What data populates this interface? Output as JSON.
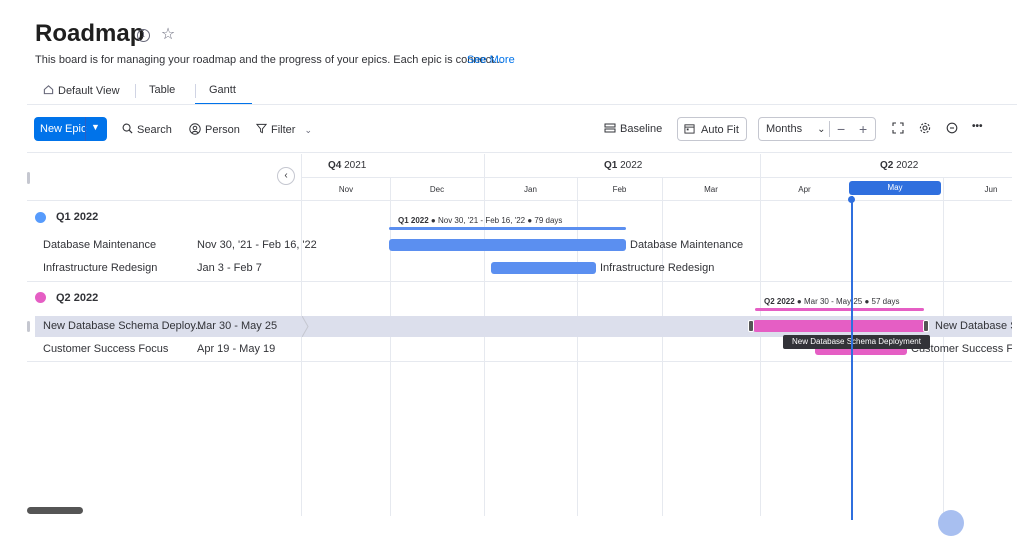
{
  "header": {
    "title": "Roadmap",
    "info_glyph": "i",
    "star_glyph": "☆",
    "description": "This board is for managing your roadmap and the progress of your epics. Each epic is connect...",
    "see_more": "See More"
  },
  "tabs": [
    {
      "label": "Default View",
      "icon": "home-icon"
    },
    {
      "label": "Table"
    },
    {
      "label": "Gantt",
      "active": true
    }
  ],
  "toolbar": {
    "new_epic": "New Epic",
    "search": "Search",
    "person": "Person",
    "filter": "Filter",
    "baseline": "Baseline",
    "auto_fit": "Auto Fit",
    "zoom_select": "Months",
    "minus": "−",
    "plus": "+",
    "more": "•••"
  },
  "timeline": {
    "quarters": [
      {
        "q": "Q4",
        "year": "2021"
      },
      {
        "q": "Q1",
        "year": "2022"
      },
      {
        "q": "Q2",
        "year": "2022"
      }
    ],
    "months": [
      "Nov",
      "Dec",
      "Jan",
      "Feb",
      "Mar",
      "Apr",
      "May",
      "Jun"
    ],
    "current_month": "May",
    "collapse_glyph": "‹"
  },
  "groups": [
    {
      "name": "Q1 2022",
      "color": "#579bfc",
      "summary_name": "Q1 2022",
      "summary_range": "Nov 30, '21 - Feb 16, '22",
      "summary_days": "79 days",
      "items": [
        {
          "name": "Database Maintenance",
          "dates": "Nov 30, '21 - Feb 16, '22",
          "bar_label": "Database Maintenance"
        },
        {
          "name": "Infrastructure Redesign",
          "dates": "Jan 3 - Feb 7",
          "bar_label": "Infrastructure Redesign"
        }
      ]
    },
    {
      "name": "Q2 2022",
      "color": "#e55ec4",
      "summary_name": "Q2 2022",
      "summary_range": "Mar 30 - May 25",
      "summary_days": "57 days",
      "items": [
        {
          "name": "New Database Schema Deploy...",
          "dates": "Mar 30 - May 25",
          "bar_label": "New Database Sc"
        },
        {
          "name": "Customer Success Focus",
          "dates": "Apr 19 - May 19",
          "bar_label": "Customer Success Foc"
        }
      ]
    }
  ],
  "tooltip": "New Database Schema Deployment",
  "colors": {
    "accent": "#0073ea",
    "q1_bar": "#5b8ff0",
    "q2_bar": "#e55ec4",
    "today": "#2f6fde"
  }
}
